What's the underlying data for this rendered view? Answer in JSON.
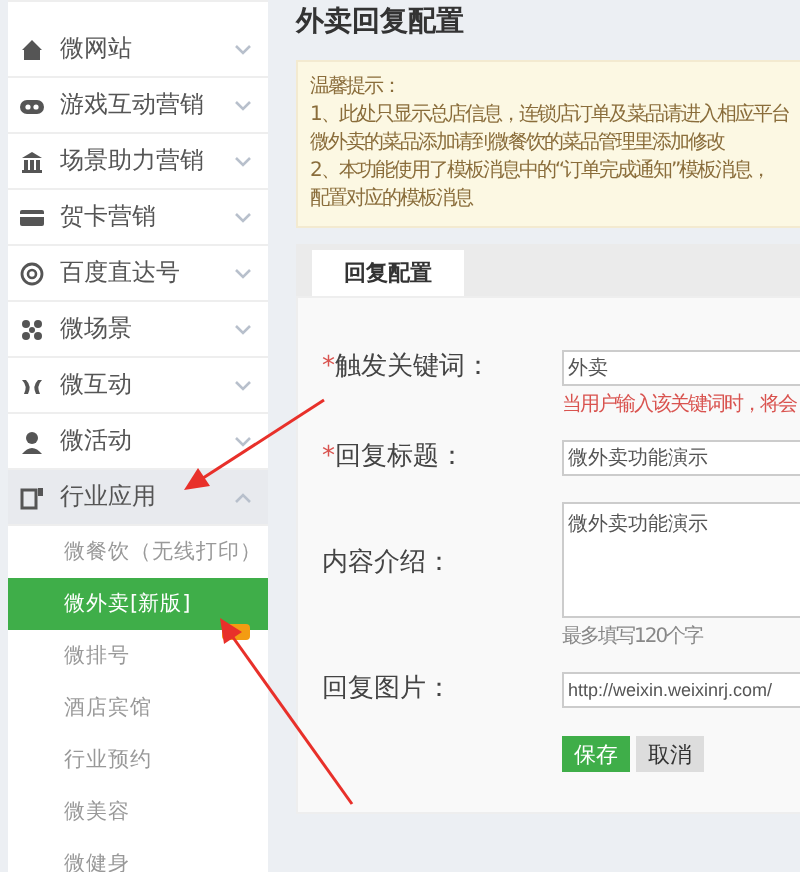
{
  "sidebar": {
    "items": [
      {
        "label": "微网站",
        "expanded": false
      },
      {
        "label": "游戏互动营销",
        "expanded": false
      },
      {
        "label": "场景助力营销",
        "expanded": false
      },
      {
        "label": "贺卡营销",
        "expanded": false
      },
      {
        "label": "百度直达号",
        "expanded": false
      },
      {
        "label": "微场景",
        "expanded": false
      },
      {
        "label": "微互动",
        "expanded": false
      },
      {
        "label": "微活动",
        "expanded": false
      },
      {
        "label": "行业应用",
        "expanded": true,
        "children": [
          {
            "label": "微餐饮（无线打印）",
            "selected": false
          },
          {
            "label": "微外卖[新版]",
            "selected": true
          },
          {
            "label": "微排号",
            "selected": false
          },
          {
            "label": "酒店宾馆",
            "selected": false
          },
          {
            "label": "行业预约",
            "selected": false
          },
          {
            "label": "微美容",
            "selected": false
          },
          {
            "label": "微健身",
            "selected": false
          }
        ]
      }
    ]
  },
  "page_title": "外卖回复配置",
  "notice": {
    "heading": "温馨提示：",
    "lines": [
      "1、此处只显示总店信息，连锁店订单及菜品请进入相应平台",
      "微外卖的菜品添加请到微餐饮的菜品管理里添加修改",
      "2、本功能使用了模板消息中的“订单完成通知”模板消息，",
      "配置对应的模板消息"
    ]
  },
  "tabs": [
    {
      "label": "回复配置",
      "selected": true
    }
  ],
  "form": {
    "fields": [
      {
        "kind": "input",
        "label": "触发关键词：",
        "required_mark": "*",
        "value": "外卖",
        "hint": {
          "text": "当用户输入该关键词时，将会",
          "kind": "error"
        }
      },
      {
        "kind": "input",
        "label": "回复标题：",
        "required_mark": "*",
        "value": "微外卖功能演示"
      },
      {
        "kind": "textarea",
        "label": "内容介绍：",
        "value": "微外卖功能演示",
        "hint": {
          "text": "最多填写120个字",
          "kind": "note"
        }
      },
      {
        "kind": "input",
        "label": "回复图片：",
        "value": "http://weixin.weixinrj.com/"
      }
    ],
    "buttons": [
      {
        "label": "保存",
        "kind": "primary"
      },
      {
        "label": "取消",
        "kind": "default"
      }
    ]
  }
}
